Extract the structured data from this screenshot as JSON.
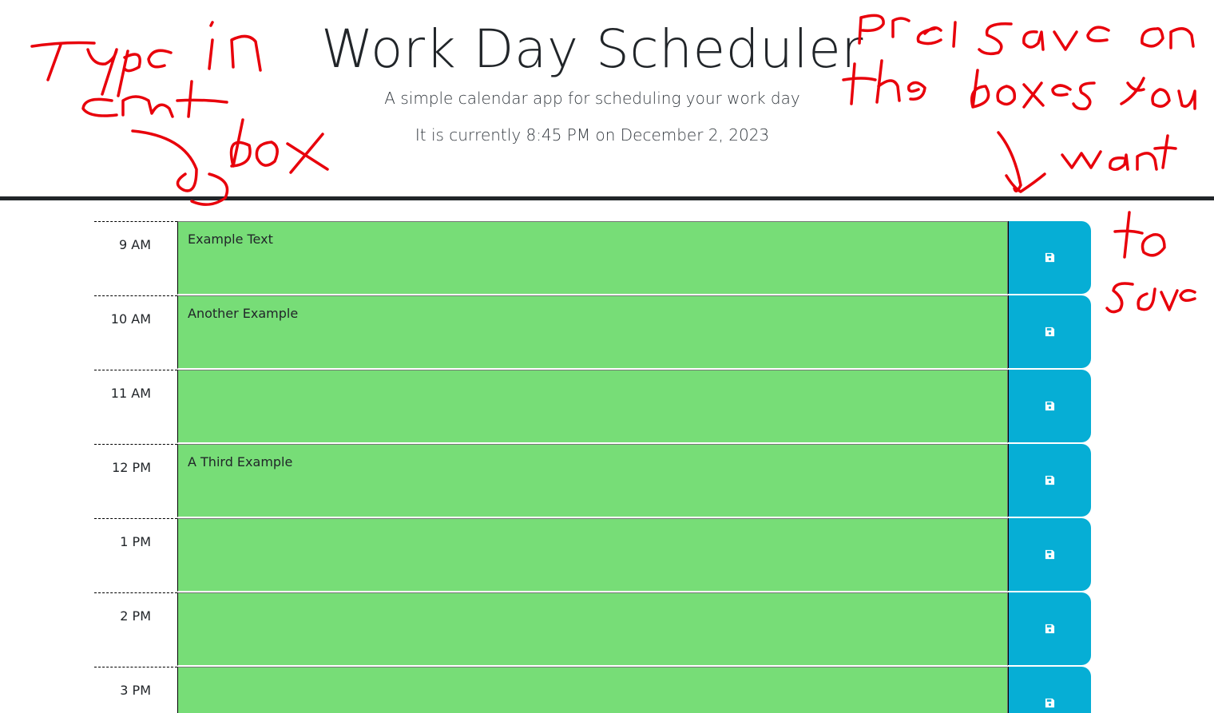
{
  "header": {
    "title": "Work Day Scheduler",
    "subtitle": "A simple calendar app for scheduling your work day",
    "current_day": "It is currently 8:45 PM on December 2, 2023"
  },
  "time_blocks": [
    {
      "hour": "9 AM",
      "text": "Example Text"
    },
    {
      "hour": "10 AM",
      "text": "Another Example"
    },
    {
      "hour": "11 AM",
      "text": ""
    },
    {
      "hour": "12 PM",
      "text": "A Third Example"
    },
    {
      "hour": "1 PM",
      "text": ""
    },
    {
      "hour": "2 PM",
      "text": ""
    },
    {
      "hour": "3 PM",
      "text": ""
    }
  ],
  "save_icon": "floppy-disk-icon",
  "colors": {
    "block_background": "#77dd77",
    "save_button": "#06aed5",
    "annotation_ink": "#e8000b"
  },
  "annotations": {
    "left_note": "type in cnt box",
    "right_note": "Press save on the boxes you want to save"
  }
}
